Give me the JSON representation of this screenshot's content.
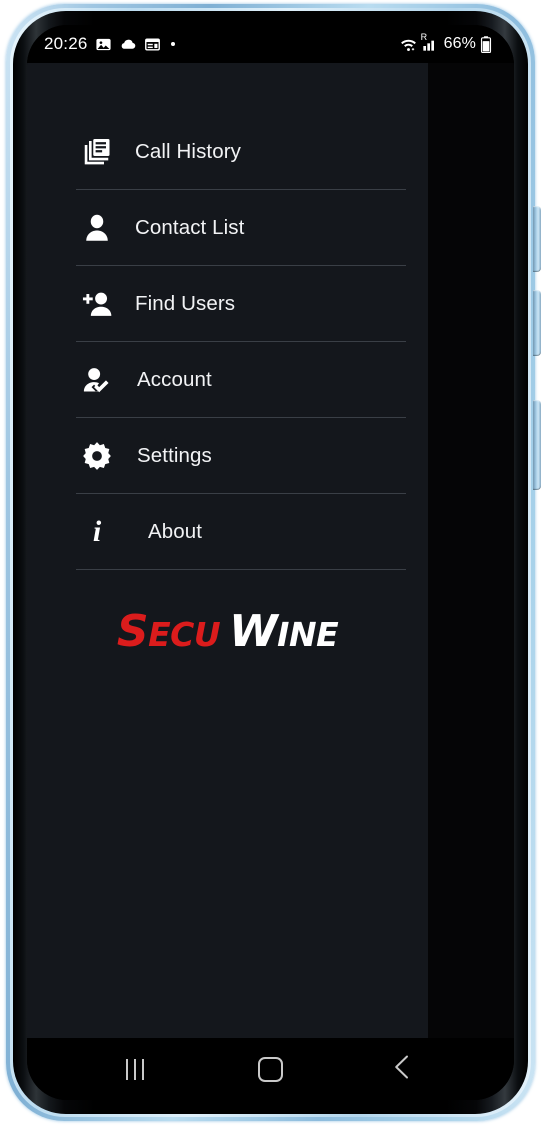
{
  "status_bar": {
    "clock": "20:26",
    "left_icons": [
      "gallery-icon",
      "cloud-icon",
      "calendar-icon",
      "dot-indicator"
    ],
    "right_icons": [
      "wifi-icon",
      "signal-icon",
      "battery-icon"
    ],
    "battery_percent": "66%",
    "roaming_label": "R"
  },
  "drawer": {
    "menu_items": [
      {
        "label": "Call History",
        "icon": "call-history-icon",
        "indent": "ind-0"
      },
      {
        "label": "Contact List",
        "icon": "contact-list-icon",
        "indent": "ind-0"
      },
      {
        "label": "Find Users",
        "icon": "find-users-icon",
        "indent": "ind-0"
      },
      {
        "label": "Account",
        "icon": "account-icon",
        "indent": "ind-1"
      },
      {
        "label": "Settings",
        "icon": "settings-gear-icon",
        "indent": "ind-1"
      },
      {
        "label": "About",
        "icon": "about-info-icon",
        "indent": "ind-2"
      }
    ],
    "logo": {
      "part1_big": "S",
      "part1_small": "ECU",
      "part2_big": "W",
      "part2_small": "INE",
      "color_red": "#db1c1c",
      "color_white": "#ffffff",
      "alt": "SecuWine"
    }
  },
  "system_nav": {
    "recents_label": "recents-button",
    "home_label": "home-button",
    "back_label": "back-button"
  },
  "device": {
    "frame_color": "#a8d2ea",
    "screen_background": "#000000",
    "drawer_background": "#14171c"
  }
}
